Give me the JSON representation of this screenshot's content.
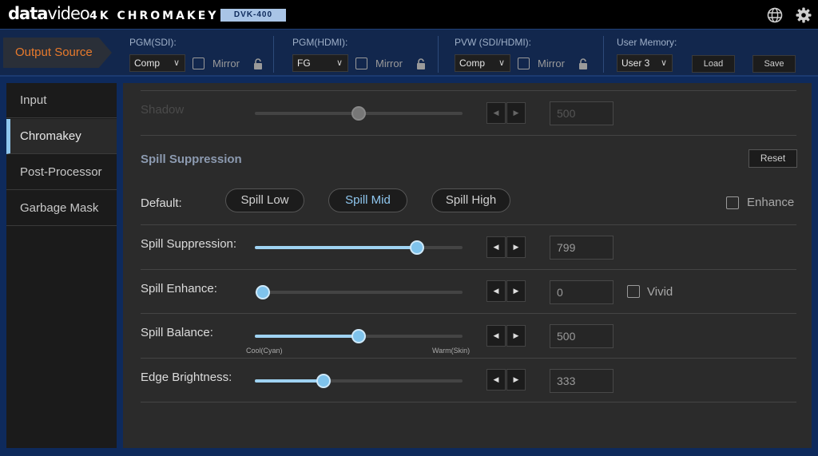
{
  "header": {
    "brand_bold": "data",
    "brand_light": "video",
    "product": "4K CHROMAKEY",
    "model": "DVK-400",
    "icons": [
      "globe-icon",
      "gear-icon"
    ]
  },
  "source_bar": {
    "output_source_label": "Output Source",
    "pgm_sdi": {
      "label": "PGM(SDI):",
      "value": "Comp",
      "mirror_label": "Mirror"
    },
    "pgm_hdmi": {
      "label": "PGM(HDMI):",
      "value": "FG",
      "mirror_label": "Mirror"
    },
    "pvw": {
      "label": "PVW (SDI/HDMI):",
      "value": "Comp",
      "mirror_label": "Mirror"
    },
    "user_memory": {
      "label": "User Memory:",
      "value": "User 3",
      "load_label": "Load",
      "save_label": "Save"
    }
  },
  "nav": {
    "items": [
      {
        "label": "Input",
        "active": false
      },
      {
        "label": "Chromakey",
        "active": true
      },
      {
        "label": "Post-Processor",
        "active": false
      },
      {
        "label": "Garbage Mask",
        "active": false
      }
    ]
  },
  "main": {
    "shadow": {
      "label": "Shadow",
      "value": "500",
      "level": 0.5
    },
    "section_title": "Spill Suppression",
    "reset_label": "Reset",
    "default_label": "Default:",
    "presets": [
      {
        "label": "Spill Low",
        "active": false
      },
      {
        "label": "Spill Mid",
        "active": true
      },
      {
        "label": "Spill High",
        "active": false
      }
    ],
    "enhance_label": "Enhance",
    "vivid_label": "Vivid",
    "sliders": [
      {
        "label": "Spill Suppression:",
        "value": "799",
        "level": 0.78
      },
      {
        "label": "Spill Enhance:",
        "value": "0",
        "level": 0.0
      },
      {
        "label": "Spill Balance:",
        "value": "500",
        "level": 0.5,
        "min_label": "Cool(Cyan)",
        "max_label": "Warm(Skin)"
      },
      {
        "label": "Edge Brightness:",
        "value": "333",
        "level": 0.33
      }
    ]
  }
}
